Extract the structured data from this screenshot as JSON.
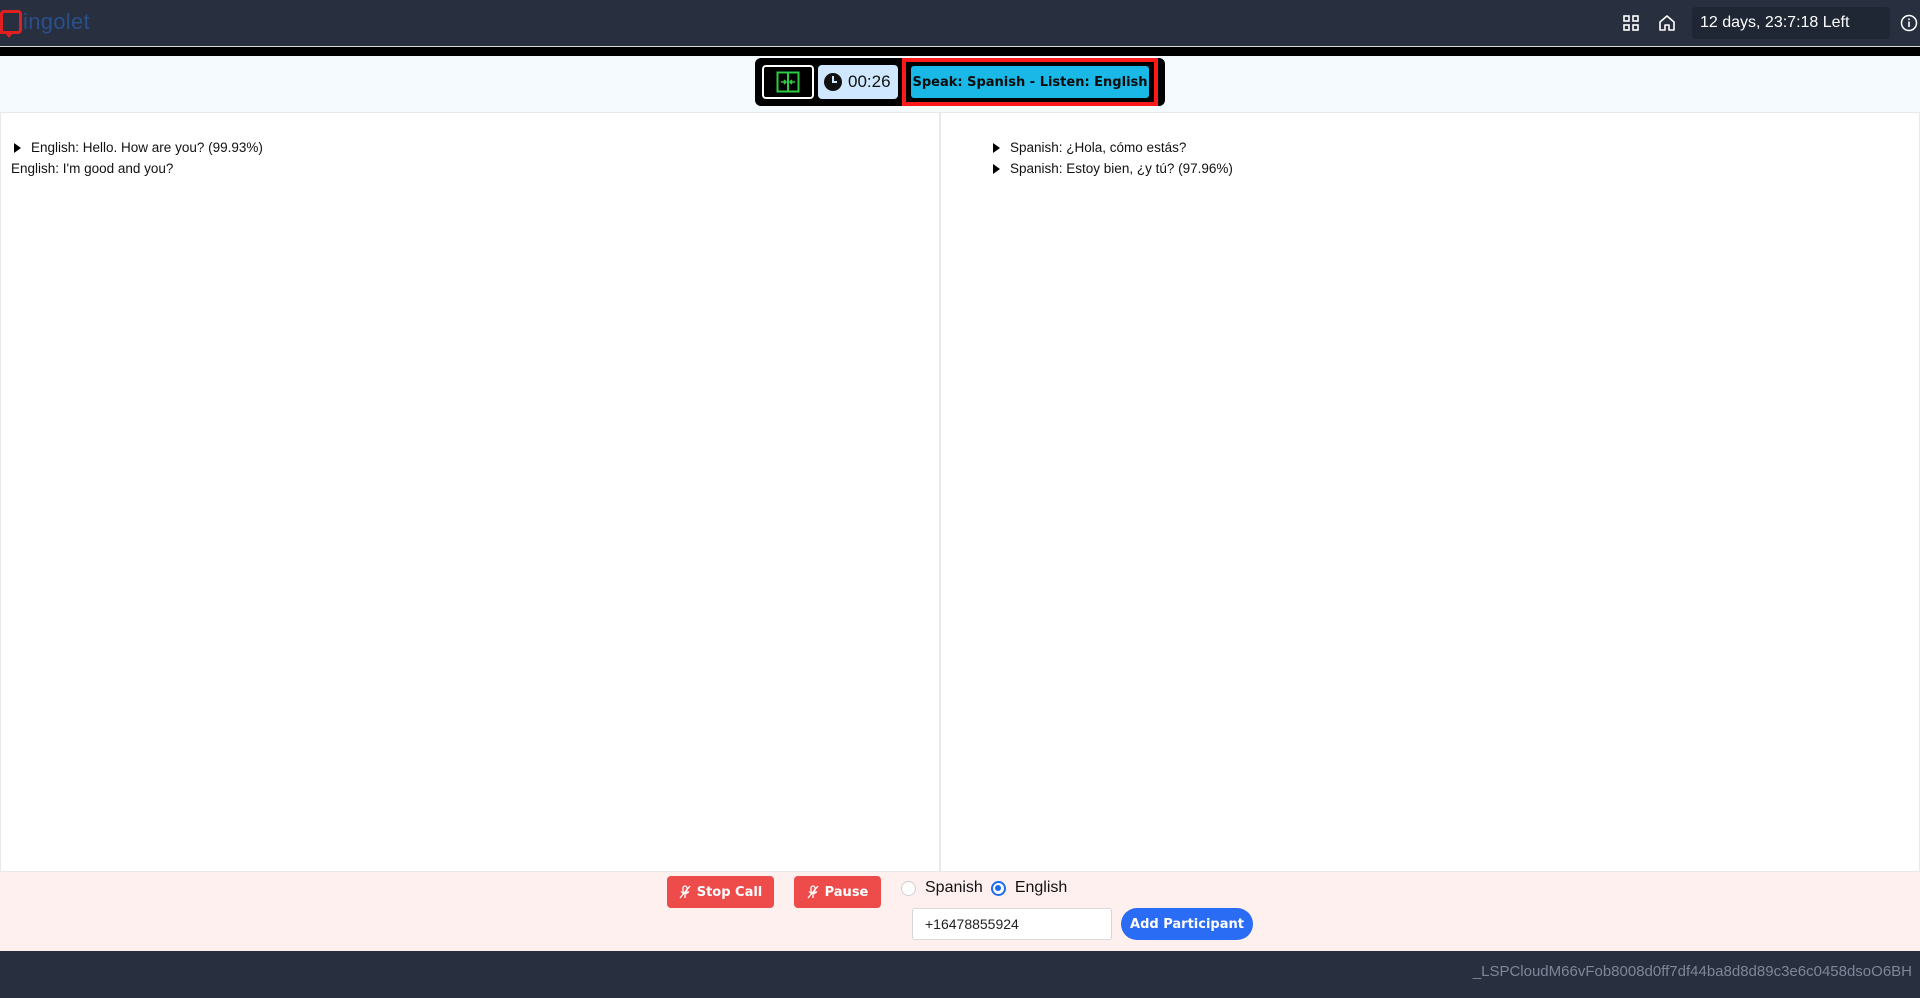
{
  "app": {
    "logo_text": "ingolet",
    "brand_color": "#e02020"
  },
  "header": {
    "time_left": "12 days, 23:7:18 Left",
    "icons": [
      "grid-icon",
      "home-icon",
      "info-icon"
    ]
  },
  "toolbar": {
    "timer": "00:26",
    "mode_label": "Speak: Spanish - Listen: English"
  },
  "transcript": {
    "left": [
      {
        "text": "English: Hello. How are you? (99.93%)",
        "expandable": true
      },
      {
        "text": "English: I'm good and you?",
        "expandable": false
      }
    ],
    "right": [
      {
        "text": "Spanish: ¿Hola, cómo estás?",
        "expandable": true
      },
      {
        "text": "Spanish: Estoy bien, ¿y tú? (97.96%)",
        "expandable": true
      }
    ]
  },
  "controls": {
    "stop_label": "Stop Call",
    "pause_label": "Pause",
    "languages": [
      {
        "label": "Spanish",
        "selected": false
      },
      {
        "label": "English",
        "selected": true
      }
    ],
    "phone_value": "+16478855924",
    "add_participant_label": "Add Participant"
  },
  "footer": {
    "session_id": "_LSPCloudM66vFob8008d0ff7df44ba8d8d89c3e6c0458dsoO6BH"
  }
}
